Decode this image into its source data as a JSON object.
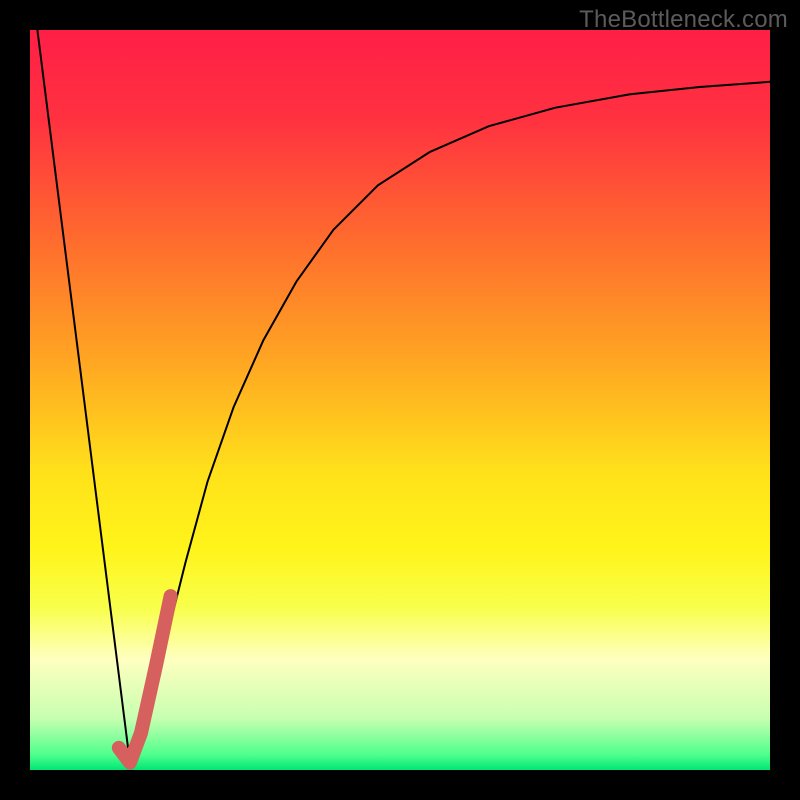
{
  "watermark": {
    "text": "TheBottleneck.com"
  },
  "chart_data": {
    "type": "line",
    "title": "",
    "xlabel": "",
    "ylabel": "",
    "xlim": [
      0,
      1
    ],
    "ylim": [
      0,
      1
    ],
    "grid": false,
    "watermark": "TheBottleneck.com",
    "background": {
      "type": "vertical_gradient",
      "stops": [
        {
          "offset": 0.0,
          "color": "#ff1f47"
        },
        {
          "offset": 0.12,
          "color": "#ff3140"
        },
        {
          "offset": 0.28,
          "color": "#ff6a2e"
        },
        {
          "offset": 0.45,
          "color": "#ffa722"
        },
        {
          "offset": 0.6,
          "color": "#ffe21a"
        },
        {
          "offset": 0.7,
          "color": "#fff41a"
        },
        {
          "offset": 0.78,
          "color": "#f8ff4a"
        },
        {
          "offset": 0.85,
          "color": "#ffffc0"
        },
        {
          "offset": 0.93,
          "color": "#c8ffb0"
        },
        {
          "offset": 0.98,
          "color": "#4dff8c"
        },
        {
          "offset": 1.0,
          "color": "#00e676"
        }
      ]
    },
    "series": [
      {
        "name": "left_descent",
        "color": "#000000",
        "width": 2,
        "x": [
          0.01,
          0.135
        ],
        "y": [
          1.0,
          0.01
        ]
      },
      {
        "name": "right_curve",
        "color": "#000000",
        "width": 2,
        "x": [
          0.135,
          0.16,
          0.185,
          0.21,
          0.24,
          0.275,
          0.315,
          0.36,
          0.41,
          0.47,
          0.54,
          0.62,
          0.71,
          0.81,
          0.905,
          1.0
        ],
        "y": [
          0.01,
          0.09,
          0.18,
          0.28,
          0.39,
          0.49,
          0.58,
          0.66,
          0.73,
          0.79,
          0.835,
          0.87,
          0.895,
          0.913,
          0.923,
          0.93
        ]
      },
      {
        "name": "highlight_hook",
        "color": "#d6605d",
        "width": 14,
        "linecap": "round",
        "x": [
          0.12,
          0.135,
          0.15,
          0.17,
          0.19
        ],
        "y": [
          0.03,
          0.01,
          0.05,
          0.14,
          0.235
        ]
      }
    ]
  }
}
